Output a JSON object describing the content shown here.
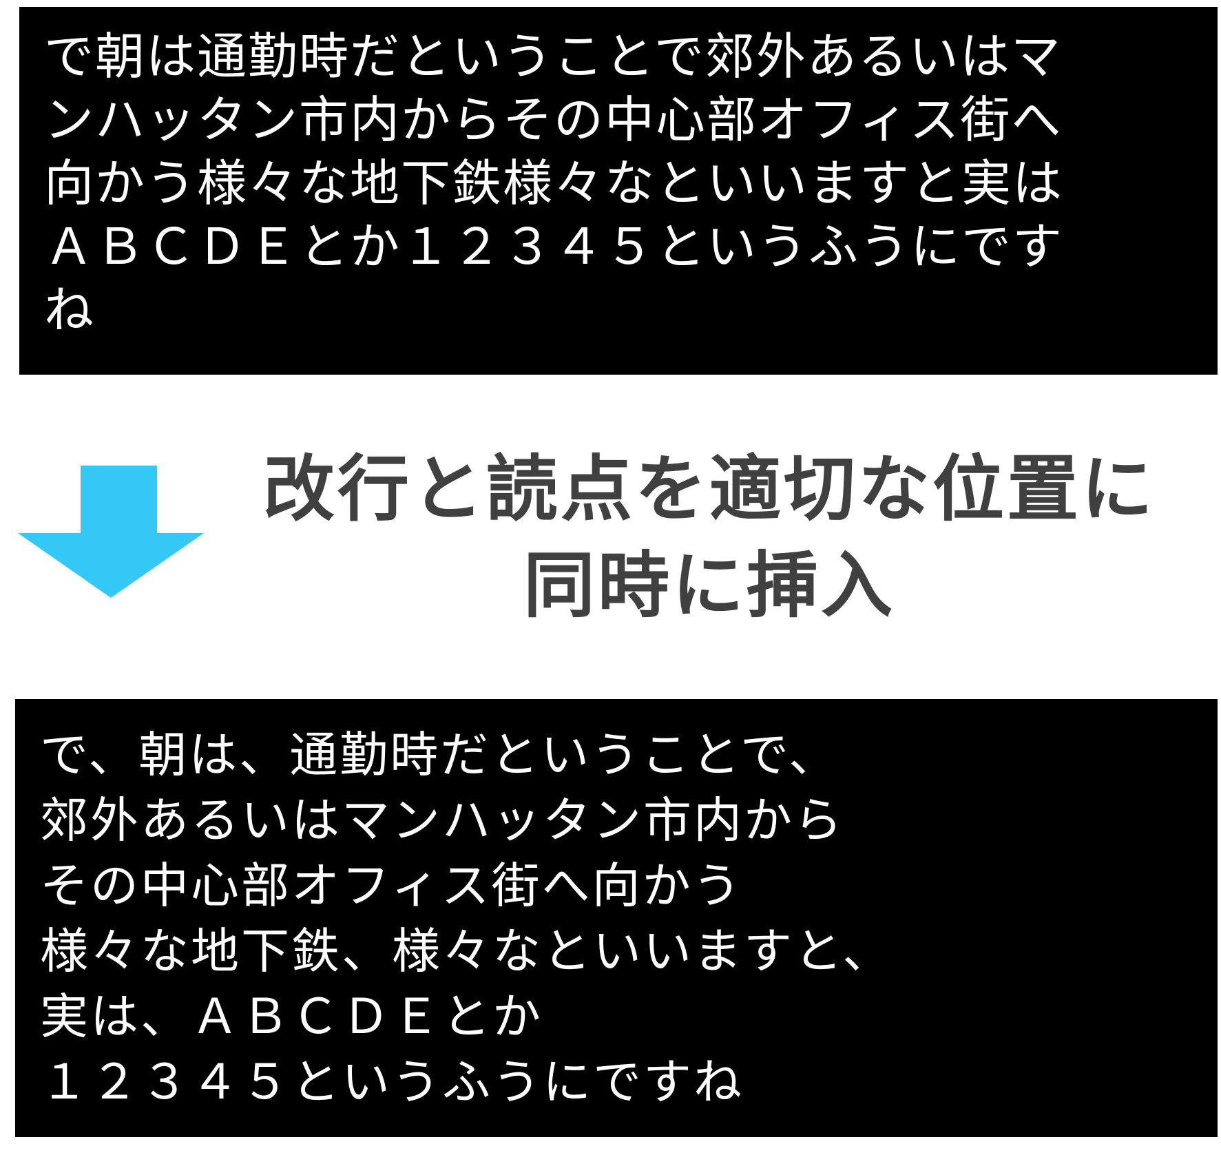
{
  "before": {
    "lines": [
      "で朝は通勤時だということで郊外あるいはマ",
      "ンハッタン市内からその中心部オフィス街へ",
      "向かう様々な地下鉄様々なといいますと実は",
      "ＡＢＣＤＥとか１２３４５というふうにです",
      "ね"
    ]
  },
  "transform": {
    "lines": [
      "改行と読点を適切な位置に",
      "同時に挿入"
    ],
    "arrow_icon": "down-arrow-icon",
    "arrow_color": "#33c8f5",
    "text_color": "#404040"
  },
  "after": {
    "lines": [
      "で、朝は、通勤時だということで、",
      "郊外あるいはマンハッタン市内から",
      "その中心部オフィス街へ向かう",
      "様々な地下鉄、様々なといいますと、",
      "実は、ＡＢＣＤＥとか",
      "１２３４５というふうにですね"
    ]
  }
}
